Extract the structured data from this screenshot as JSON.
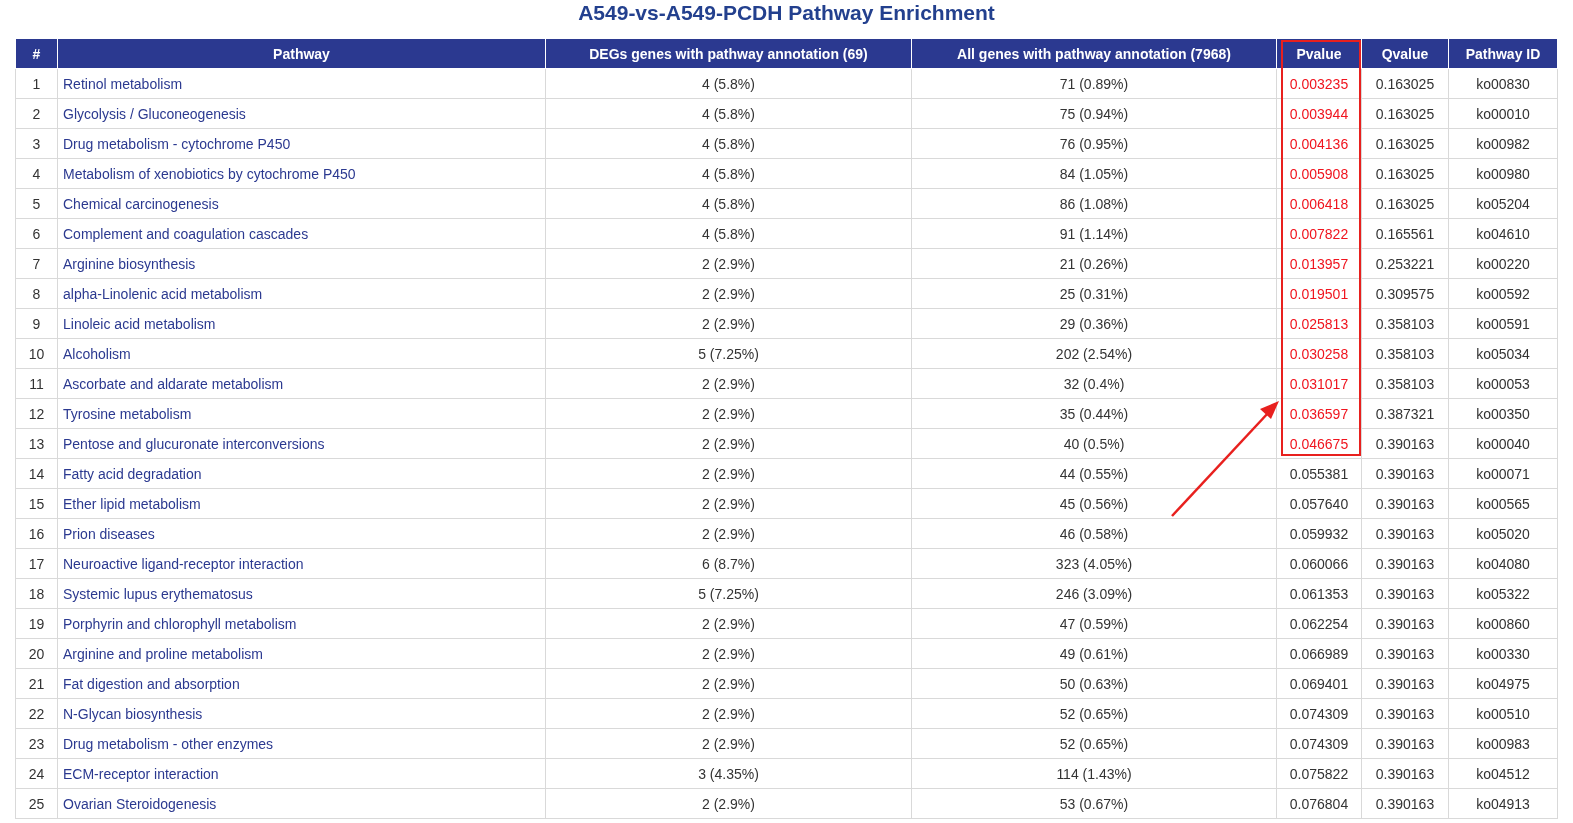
{
  "title": "A549-vs-A549-PCDH Pathway Enrichment",
  "columns": [
    "#",
    "Pathway",
    "DEGs genes with pathway annotation (69)",
    "All genes with pathway annotation (7968)",
    "Pvalue",
    "Qvalue",
    "Pathway ID"
  ],
  "rows": [
    {
      "num": "1",
      "pathway": "Retinol metabolism",
      "degs": "4 (5.8%)",
      "all": "71 (0.89%)",
      "pvalue": "0.003235",
      "qvalue": "0.163025",
      "id": "ko00830",
      "highlighted": true
    },
    {
      "num": "2",
      "pathway": "Glycolysis / Gluconeogenesis",
      "degs": "4 (5.8%)",
      "all": "75 (0.94%)",
      "pvalue": "0.003944",
      "qvalue": "0.163025",
      "id": "ko00010",
      "highlighted": true
    },
    {
      "num": "3",
      "pathway": "Drug metabolism - cytochrome P450",
      "degs": "4 (5.8%)",
      "all": "76 (0.95%)",
      "pvalue": "0.004136",
      "qvalue": "0.163025",
      "id": "ko00982",
      "highlighted": true
    },
    {
      "num": "4",
      "pathway": "Metabolism of xenobiotics by cytochrome P450",
      "degs": "4 (5.8%)",
      "all": "84 (1.05%)",
      "pvalue": "0.005908",
      "qvalue": "0.163025",
      "id": "ko00980",
      "highlighted": true
    },
    {
      "num": "5",
      "pathway": "Chemical carcinogenesis",
      "degs": "4 (5.8%)",
      "all": "86 (1.08%)",
      "pvalue": "0.006418",
      "qvalue": "0.163025",
      "id": "ko05204",
      "highlighted": true
    },
    {
      "num": "6",
      "pathway": "Complement and coagulation cascades",
      "degs": "4 (5.8%)",
      "all": "91 (1.14%)",
      "pvalue": "0.007822",
      "qvalue": "0.165561",
      "id": "ko04610",
      "highlighted": true
    },
    {
      "num": "7",
      "pathway": "Arginine biosynthesis",
      "degs": "2 (2.9%)",
      "all": "21 (0.26%)",
      "pvalue": "0.013957",
      "qvalue": "0.253221",
      "id": "ko00220",
      "highlighted": true
    },
    {
      "num": "8",
      "pathway": "alpha-Linolenic acid metabolism",
      "degs": "2 (2.9%)",
      "all": "25 (0.31%)",
      "pvalue": "0.019501",
      "qvalue": "0.309575",
      "id": "ko00592",
      "highlighted": true
    },
    {
      "num": "9",
      "pathway": "Linoleic acid metabolism",
      "degs": "2 (2.9%)",
      "all": "29 (0.36%)",
      "pvalue": "0.025813",
      "qvalue": "0.358103",
      "id": "ko00591",
      "highlighted": true
    },
    {
      "num": "10",
      "pathway": "Alcoholism",
      "degs": "5 (7.25%)",
      "all": "202 (2.54%)",
      "pvalue": "0.030258",
      "qvalue": "0.358103",
      "id": "ko05034",
      "highlighted": true
    },
    {
      "num": "11",
      "pathway": "Ascorbate and aldarate metabolism",
      "degs": "2 (2.9%)",
      "all": "32 (0.4%)",
      "pvalue": "0.031017",
      "qvalue": "0.358103",
      "id": "ko00053",
      "highlighted": true
    },
    {
      "num": "12",
      "pathway": "Tyrosine metabolism",
      "degs": "2 (2.9%)",
      "all": "35 (0.44%)",
      "pvalue": "0.036597",
      "qvalue": "0.387321",
      "id": "ko00350",
      "highlighted": true
    },
    {
      "num": "13",
      "pathway": "Pentose and glucuronate interconversions",
      "degs": "2 (2.9%)",
      "all": "40 (0.5%)",
      "pvalue": "0.046675",
      "qvalue": "0.390163",
      "id": "ko00040",
      "highlighted": true
    },
    {
      "num": "14",
      "pathway": "Fatty acid degradation",
      "degs": "2 (2.9%)",
      "all": "44 (0.55%)",
      "pvalue": "0.055381",
      "qvalue": "0.390163",
      "id": "ko00071",
      "highlighted": false
    },
    {
      "num": "15",
      "pathway": "Ether lipid metabolism",
      "degs": "2 (2.9%)",
      "all": "45 (0.56%)",
      "pvalue": "0.057640",
      "qvalue": "0.390163",
      "id": "ko00565",
      "highlighted": false
    },
    {
      "num": "16",
      "pathway": "Prion diseases",
      "degs": "2 (2.9%)",
      "all": "46 (0.58%)",
      "pvalue": "0.059932",
      "qvalue": "0.390163",
      "id": "ko05020",
      "highlighted": false
    },
    {
      "num": "17",
      "pathway": "Neuroactive ligand-receptor interaction",
      "degs": "6 (8.7%)",
      "all": "323 (4.05%)",
      "pvalue": "0.060066",
      "qvalue": "0.390163",
      "id": "ko04080",
      "highlighted": false
    },
    {
      "num": "18",
      "pathway": "Systemic lupus erythematosus",
      "degs": "5 (7.25%)",
      "all": "246 (3.09%)",
      "pvalue": "0.061353",
      "qvalue": "0.390163",
      "id": "ko05322",
      "highlighted": false
    },
    {
      "num": "19",
      "pathway": "Porphyrin and chlorophyll metabolism",
      "degs": "2 (2.9%)",
      "all": "47 (0.59%)",
      "pvalue": "0.062254",
      "qvalue": "0.390163",
      "id": "ko00860",
      "highlighted": false
    },
    {
      "num": "20",
      "pathway": "Arginine and proline metabolism",
      "degs": "2 (2.9%)",
      "all": "49 (0.61%)",
      "pvalue": "0.066989",
      "qvalue": "0.390163",
      "id": "ko00330",
      "highlighted": false
    },
    {
      "num": "21",
      "pathway": "Fat digestion and absorption",
      "degs": "2 (2.9%)",
      "all": "50 (0.63%)",
      "pvalue": "0.069401",
      "qvalue": "0.390163",
      "id": "ko04975",
      "highlighted": false
    },
    {
      "num": "22",
      "pathway": "N-Glycan biosynthesis",
      "degs": "2 (2.9%)",
      "all": "52 (0.65%)",
      "pvalue": "0.074309",
      "qvalue": "0.390163",
      "id": "ko00510",
      "highlighted": false
    },
    {
      "num": "23",
      "pathway": "Drug metabolism - other enzymes",
      "degs": "2 (2.9%)",
      "all": "52 (0.65%)",
      "pvalue": "0.074309",
      "qvalue": "0.390163",
      "id": "ko00983",
      "highlighted": false
    },
    {
      "num": "24",
      "pathway": "ECM-receptor interaction",
      "degs": "3 (4.35%)",
      "all": "114 (1.43%)",
      "pvalue": "0.075822",
      "qvalue": "0.390163",
      "id": "ko04512",
      "highlighted": false
    },
    {
      "num": "25",
      "pathway": "Ovarian Steroidogenesis",
      "degs": "2 (2.9%)",
      "all": "53 (0.67%)",
      "pvalue": "0.076804",
      "qvalue": "0.390163",
      "id": "ko04913",
      "highlighted": false
    }
  ]
}
